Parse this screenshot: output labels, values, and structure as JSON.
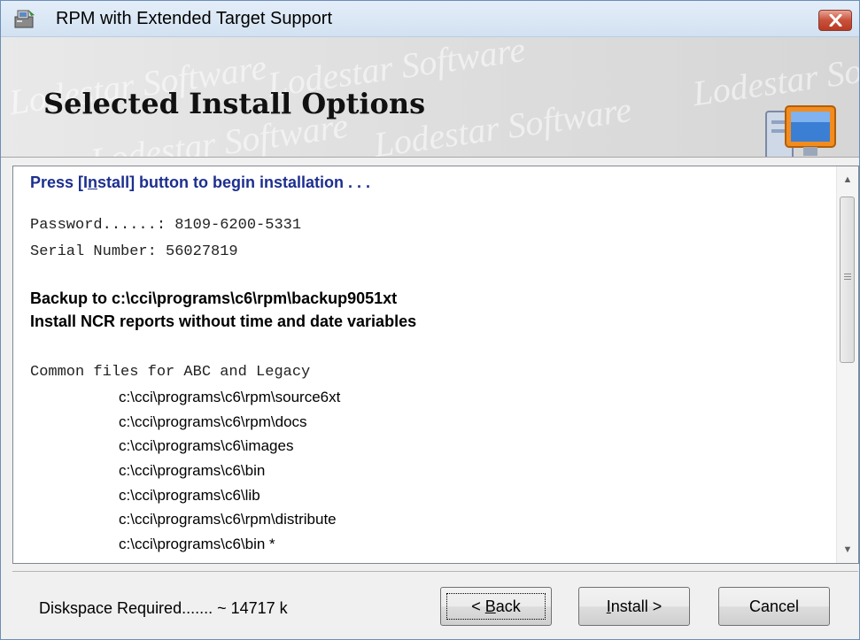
{
  "window": {
    "title": "RPM with Extended Target Support"
  },
  "banner": {
    "title": "Selected Install Options",
    "watermark": "Lodestar Software"
  },
  "content": {
    "instruction_prefix": "Press [I",
    "instruction_underlined": "n",
    "instruction_suffix": "stall] button to begin installation . . .",
    "password_line": "Password......: 8109-6200-5331",
    "serial_line": "Serial Number: 56027819",
    "backup_line": "Backup to c:\\cci\\programs\\c6\\rpm\\backup9051xt",
    "ncr_line": "Install NCR reports without time and date variables",
    "common_files_header": "Common files for ABC and Legacy",
    "paths": [
      "c:\\cci\\programs\\c6\\rpm\\source6xt",
      "c:\\cci\\programs\\c6\\rpm\\docs",
      "c:\\cci\\programs\\c6\\images",
      "c:\\cci\\programs\\c6\\bin",
      "c:\\cci\\programs\\c6\\lib",
      "c:\\cci\\programs\\c6\\rpm\\distribute",
      "c:\\cci\\programs\\c6\\bin *"
    ]
  },
  "footer": {
    "diskspace": "Diskspace Required....... ~ 14717 k",
    "back_label_prefix": "< ",
    "back_label_underlined": "B",
    "back_label_suffix": "ack",
    "install_label_underlined": "I",
    "install_label_suffix": "nstall >",
    "cancel_label": "Cancel"
  },
  "icons": {
    "app": "installer-icon",
    "close": "close-icon",
    "computer": "computer-icon"
  },
  "colors": {
    "instruction_text": "#1d2f8f",
    "close_button": "#c9513b"
  }
}
